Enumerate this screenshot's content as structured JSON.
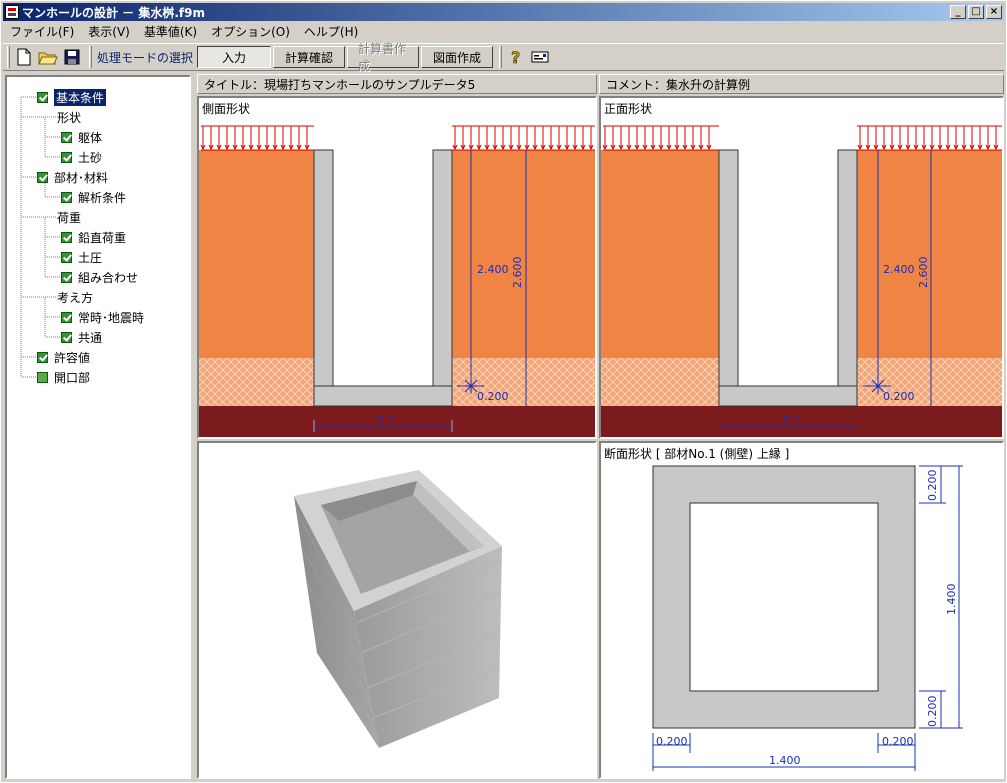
{
  "window": {
    "title": "マンホールの設計 － 集水桝.f9m",
    "buttons": {
      "minimize": "_",
      "maximize": "□",
      "close": "×"
    }
  },
  "menu": [
    "ファイル(F)",
    "表示(V)",
    "基準値(K)",
    "オプション(O)",
    "ヘルプ(H)"
  ],
  "toolbar": {
    "mode_label": "処理モードの選択",
    "modes": [
      {
        "label": "入力",
        "state": "pressed"
      },
      {
        "label": "計算確認",
        "state": "normal"
      },
      {
        "label": "計算書作成",
        "state": "disabled"
      },
      {
        "label": "図面作成",
        "state": "normal"
      }
    ]
  },
  "tree": [
    {
      "label": "基本条件",
      "level": 0,
      "check": "checked",
      "selected": true
    },
    {
      "label": "形状",
      "level": 1,
      "check": "none"
    },
    {
      "label": "躯体",
      "level": 2,
      "check": "checked"
    },
    {
      "label": "土砂",
      "level": 2,
      "check": "checked"
    },
    {
      "label": "部材･材料",
      "level": 0,
      "check": "checked"
    },
    {
      "label": "解析条件",
      "level": 2,
      "check": "checked"
    },
    {
      "label": "荷重",
      "level": 1,
      "check": "none"
    },
    {
      "label": "鉛直荷重",
      "level": 2,
      "check": "checked"
    },
    {
      "label": "土圧",
      "level": 2,
      "check": "checked"
    },
    {
      "label": "組み合わせ",
      "level": 2,
      "check": "checked"
    },
    {
      "label": "考え方",
      "level": 1,
      "check": "none"
    },
    {
      "label": "常時･地震時",
      "level": 2,
      "check": "checked"
    },
    {
      "label": "共通",
      "level": 2,
      "check": "checked"
    },
    {
      "label": "許容値",
      "level": 0,
      "check": "checked"
    },
    {
      "label": "開口部",
      "level": 0,
      "check": "unchecked"
    }
  ],
  "header": {
    "title": "タイトル：現場打ちマンホールのサンプルデータ5",
    "comment": "コメント：集水升の計算例"
  },
  "side_view": {
    "caption": "側面形状",
    "dim_inner": "2.400",
    "dim_outer": "2.600",
    "dim_bottom": "0.200",
    "dim_width": "1.1"
  },
  "front_view": {
    "caption": "正面形状",
    "dim_inner": "2.400",
    "dim_outer": "2.600",
    "dim_bottom": "0.200",
    "dim_width": "1.1"
  },
  "section_view": {
    "caption": "断面形状 [ 部材No.1 (側壁) 上縁 ]",
    "dim_top": "0.200",
    "dim_height": "1.400",
    "dim_bottom": "0.200",
    "dim_left": "0.200",
    "dim_right": "0.200",
    "dim_width": "1.400"
  },
  "colors": {
    "soil": "#ef8445",
    "soil_hatch": "#f3a577",
    "base": "#7b1b1e",
    "concrete": "#c8c8c8",
    "load": "#d40000",
    "dim": "#1a2fb8"
  }
}
